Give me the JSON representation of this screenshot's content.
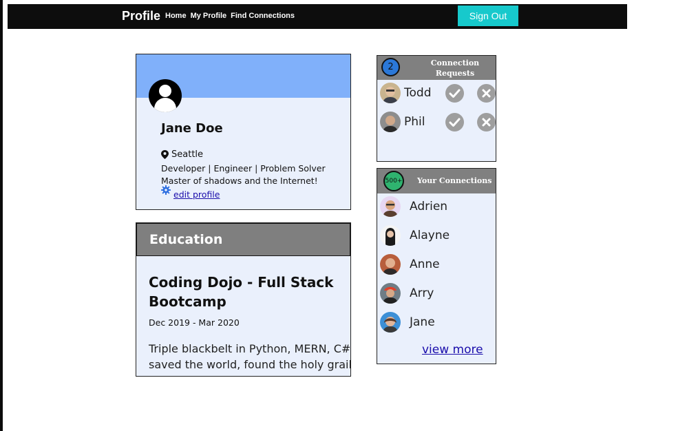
{
  "nav": {
    "brand": "Profile",
    "links": [
      "Home",
      "My Profile",
      "Find Connections"
    ],
    "signout_label": "Sign Out",
    "signout_color": "#17c9cc"
  },
  "profile": {
    "name": "Jane Doe",
    "location": "Seattle",
    "headline": "Developer | Engineer | Problem Solver",
    "bio": "Master of shadows and the Internet!",
    "edit_label": "edit profile",
    "banner_color": "#80b0fa"
  },
  "education": {
    "header": "Education",
    "school": "Coding Dojo - Full Stack Bootcamp",
    "dates": "Dec 2019 - Mar 2020",
    "description_lines": [
      "Triple blackbelt in Python, MERN, C#,",
      "saved the world, found the holy grail"
    ]
  },
  "requests": {
    "count": "2",
    "title_lines": [
      "Connection",
      "Requests"
    ],
    "items": [
      {
        "name": "Todd",
        "accept_icon": "check-icon",
        "decline_icon": "x-icon"
      },
      {
        "name": "Phil",
        "accept_icon": "check-icon",
        "decline_icon": "x-icon"
      }
    ]
  },
  "connections": {
    "count": "500+",
    "title": "Your Connections",
    "items": [
      {
        "name": "Adrien"
      },
      {
        "name": "Alayne"
      },
      {
        "name": "Anne"
      },
      {
        "name": "Arry"
      },
      {
        "name": "Jane"
      }
    ],
    "view_more": "view more"
  }
}
